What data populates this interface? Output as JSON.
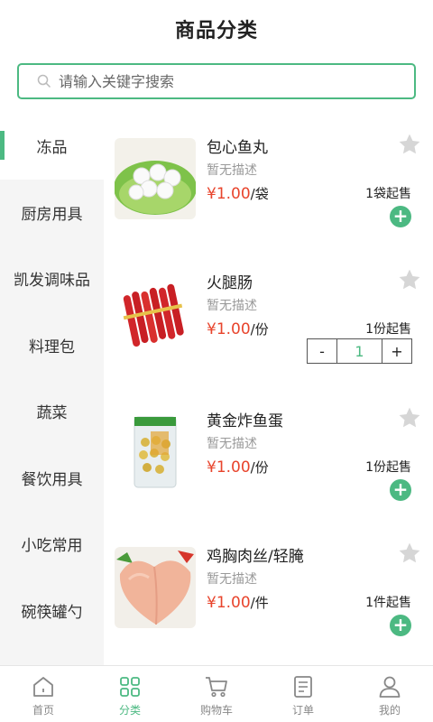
{
  "header": {
    "title": "商品分类"
  },
  "search": {
    "placeholder": "请输入关键字搜索"
  },
  "sidebar": {
    "items": [
      {
        "label": "冻品",
        "active": true
      },
      {
        "label": "厨房用具"
      },
      {
        "label": "凯发调味品"
      },
      {
        "label": "料理包"
      },
      {
        "label": "蔬菜"
      },
      {
        "label": "餐饮用具"
      },
      {
        "label": "小吃常用"
      },
      {
        "label": "碗筷罐勺"
      }
    ]
  },
  "products": [
    {
      "name": "包心鱼丸",
      "desc": "暂无描述",
      "price": "¥1.00",
      "unit": "/袋",
      "moq": "1袋起售",
      "action": "add"
    },
    {
      "name": "火腿肠",
      "desc": "暂无描述",
      "price": "¥1.00",
      "unit": "/份",
      "moq": "1份起售",
      "action": "stepper",
      "stepper": {
        "minus": "-",
        "value": "1",
        "plus": "+"
      }
    },
    {
      "name": "黄金炸鱼蛋",
      "desc": "暂无描述",
      "price": "¥1.00",
      "unit": "/份",
      "moq": "1份起售",
      "action": "add"
    },
    {
      "name": "鸡胸肉丝/轻腌",
      "desc": "暂无描述",
      "price": "¥1.00",
      "unit": "/件",
      "moq": "1件起售",
      "action": "add"
    }
  ],
  "add_symbol": "+",
  "tabbar": {
    "items": [
      {
        "label": "首页",
        "icon": "home-icon"
      },
      {
        "label": "分类",
        "icon": "category-icon",
        "active": true
      },
      {
        "label": "购物车",
        "icon": "cart-icon"
      },
      {
        "label": "订单",
        "icon": "order-icon"
      },
      {
        "label": "我的",
        "icon": "user-icon"
      }
    ]
  },
  "colors": {
    "accent": "#4cb982",
    "price": "#e8442c",
    "sidebar_bg": "#f5f5f5"
  }
}
